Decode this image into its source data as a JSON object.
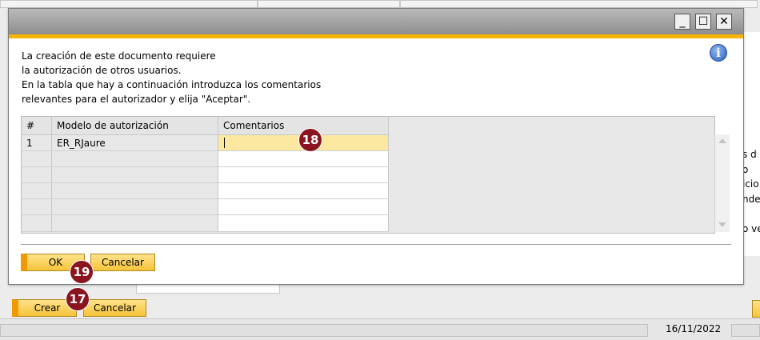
{
  "dialog": {
    "message_lines": [
      "La creación de este documento requiere",
      "la autorización de otros usuarios.",
      "En la tabla que hay a continuación introduzca los comentarios",
      "relevantes para el autorizador y elija \"Aceptar\"."
    ],
    "info_icon_glyph": "i",
    "window_buttons": {
      "minimize": "_",
      "maximize": "☐",
      "close": "✕"
    },
    "table": {
      "headers": [
        "#",
        "Modelo de autorización",
        "Comentarios"
      ],
      "rows": [
        {
          "num": "1",
          "model": "ER_RJaure",
          "comment": ""
        }
      ]
    },
    "ok_label": "OK",
    "cancel_label": "Cancelar"
  },
  "background": {
    "create_label": "Crear",
    "cancel_label": "Cancelar",
    "right_texts": [
      "s d",
      "o",
      "icio",
      "nde",
      "o ve"
    ],
    "status_date": "16/11/2022"
  },
  "markers": {
    "comment_cell": "18",
    "ok_button": "19",
    "create_button": "17"
  },
  "colors": {
    "accent": "#f5b400",
    "button": "#f6c43a",
    "badge": "#8a1420",
    "active_cell": "#fce8a0"
  }
}
